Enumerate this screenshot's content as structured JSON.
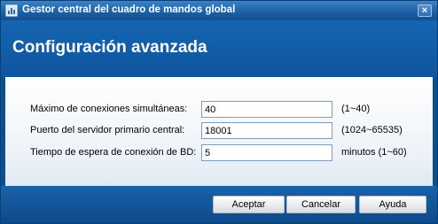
{
  "window": {
    "title": "Gestor central del cuadro de mandos global",
    "close_label": "×"
  },
  "header": {
    "title": "Configuración avanzada"
  },
  "form": {
    "fields": [
      {
        "label": "Máximo de conexiones simultáneas:",
        "value": "40",
        "hint": "(1~40)"
      },
      {
        "label": "Puerto del servidor primario central:",
        "value": "18001",
        "hint": "(1024~65535)"
      },
      {
        "label": "Tiempo de espera de conexión de BD:",
        "value": "5",
        "hint": "minutos (1~60)"
      }
    ]
  },
  "buttons": {
    "accept": "Aceptar",
    "cancel": "Cancelar",
    "help": "Ayuda"
  },
  "colors": {
    "titlebar": "#1b5ea3",
    "header": "#1565b2",
    "footer": "#0c4a89"
  }
}
